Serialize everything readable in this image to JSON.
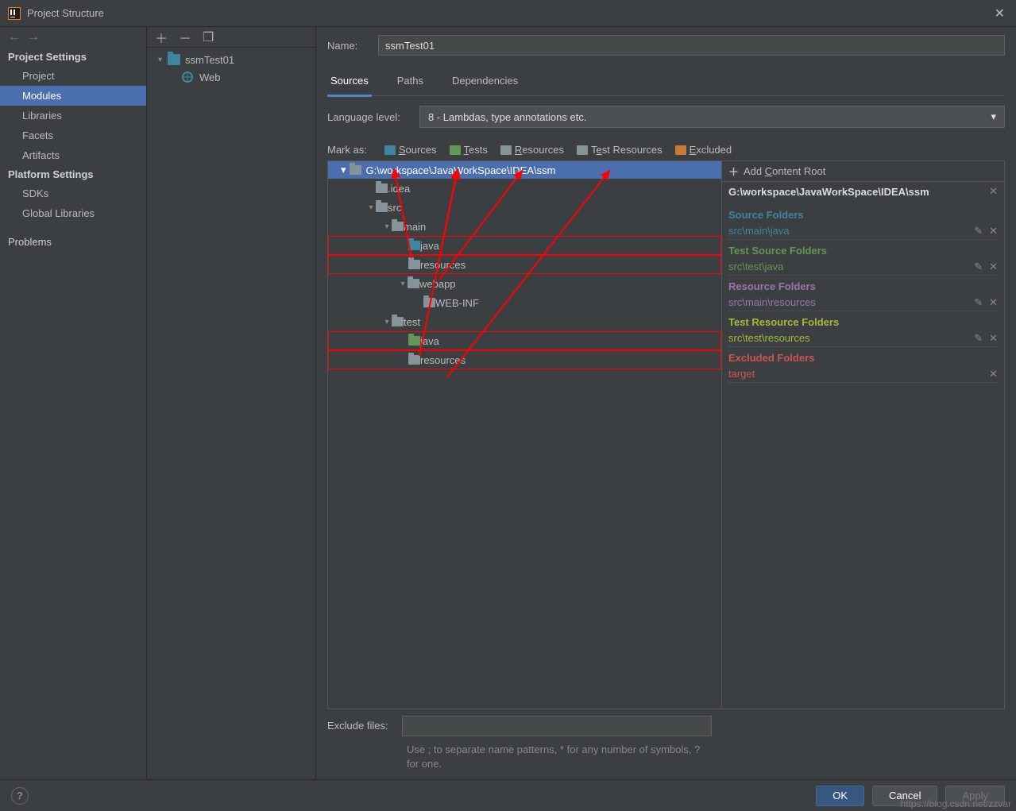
{
  "window": {
    "title": "Project Structure"
  },
  "sidebar": {
    "section1": "Project Settings",
    "items1": [
      "Project",
      "Modules",
      "Libraries",
      "Facets",
      "Artifacts"
    ],
    "section2": "Platform Settings",
    "items2": [
      "SDKs",
      "Global Libraries"
    ],
    "section3": "Problems"
  },
  "modules_tree": {
    "root": "ssmTest01",
    "child": "Web"
  },
  "name_field": {
    "label": "Name:",
    "value": "ssmTest01"
  },
  "tabs": [
    "Sources",
    "Paths",
    "Dependencies"
  ],
  "language_level": {
    "label": "Language level:",
    "value": "8 - Lambdas, type annotations etc."
  },
  "mark_as": {
    "label": "Mark as:",
    "sources": "Sources",
    "tests": "Tests",
    "resources": "Resources",
    "test_resources": "Test Resources",
    "excluded": "Excluded"
  },
  "dir_tree": {
    "root": "G:\\workspace\\JavaWorkSpace\\IDEA\\ssm",
    "idea": ".idea",
    "src": "src",
    "main": "main",
    "main_java": "java",
    "main_res": "resources",
    "webapp": "webapp",
    "webinf": "WEB-INF",
    "test": "test",
    "test_java": "java",
    "test_res": "resources"
  },
  "content_root": {
    "add_label": "Add Content Root",
    "path": "G:\\workspace\\JavaWorkSpace\\IDEA\\ssm",
    "source_folders_title": "Source Folders",
    "source_folders": [
      "src\\main\\java"
    ],
    "test_source_folders_title": "Test Source Folders",
    "test_source_folders": [
      "src\\test\\java"
    ],
    "resource_folders_title": "Resource Folders",
    "resource_folders": [
      "src\\main\\resources"
    ],
    "test_resource_folders_title": "Test Resource Folders",
    "test_resource_folders": [
      "src\\test\\resources"
    ],
    "excluded_folders_title": "Excluded Folders",
    "excluded_folders": [
      "target"
    ]
  },
  "exclude_files": {
    "label": "Exclude files:",
    "value": "",
    "hint": "Use ; to separate name patterns, * for any number of symbols, ? for one."
  },
  "buttons": {
    "ok": "OK",
    "cancel": "Cancel",
    "apply": "Apply"
  },
  "watermark": "https://blog.csdn.net/zzvar",
  "colors": {
    "sources": "#3e86a0",
    "tests": "#629755",
    "resources": "#9876aa",
    "test_resources": "#a1a12a",
    "excluded": "#cc7832"
  }
}
